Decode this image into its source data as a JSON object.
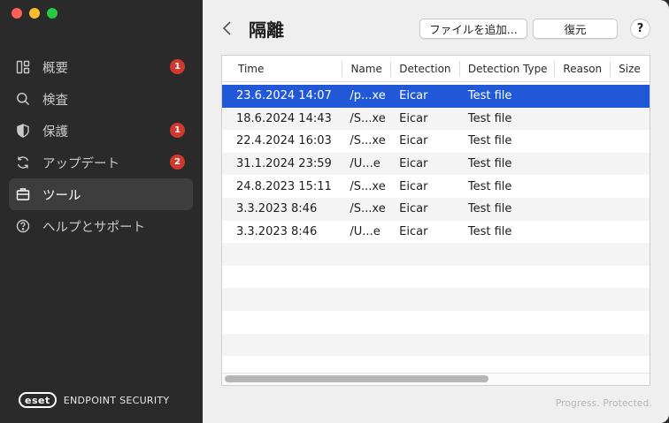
{
  "sidebar": {
    "items": [
      {
        "label": "概要",
        "icon": "dashboard-icon",
        "badge": "1"
      },
      {
        "label": "検査",
        "icon": "search-icon",
        "badge": ""
      },
      {
        "label": "保護",
        "icon": "shield-icon",
        "badge": "1"
      },
      {
        "label": "アップデート",
        "icon": "refresh-icon",
        "badge": "2"
      },
      {
        "label": "ツール",
        "icon": "briefcase-icon",
        "badge": ""
      },
      {
        "label": "ヘルプとサポート",
        "icon": "help-icon",
        "badge": ""
      }
    ],
    "active_index": 4,
    "brand_logo": "eset",
    "brand_text": "ENDPOINT SECURITY"
  },
  "header": {
    "title": "隔離",
    "add_file_label": "ファイルを追加...",
    "restore_label": "復元",
    "help_label": "?"
  },
  "table": {
    "columns": [
      "Time",
      "Name",
      "Detection",
      "Detection Type",
      "Reason",
      "Size"
    ],
    "rows": [
      {
        "time": "23.6.2024 14:07",
        "name": "/p...xe",
        "detection": "Eicar",
        "type": "Test file",
        "reason": "",
        "size": "",
        "selected": true
      },
      {
        "time": "18.6.2024 14:43",
        "name": "/S...xe",
        "detection": "Eicar",
        "type": "Test file",
        "reason": "",
        "size": ""
      },
      {
        "time": "22.4.2024 16:03",
        "name": "/S...xe",
        "detection": "Eicar",
        "type": "Test file",
        "reason": "",
        "size": ""
      },
      {
        "time": "31.1.2024 23:59",
        "name": "/U...e",
        "detection": "Eicar",
        "type": "Test file",
        "reason": "",
        "size": ""
      },
      {
        "time": "24.8.2023 15:11",
        "name": "/S...xe",
        "detection": "Eicar",
        "type": "Test file",
        "reason": "",
        "size": ""
      },
      {
        "time": "3.3.2023 8:46",
        "name": "/S...xe",
        "detection": "Eicar",
        "type": "Test file",
        "reason": "",
        "size": ""
      },
      {
        "time": "3.3.2023 8:46",
        "name": "/U...e",
        "detection": "Eicar",
        "type": "Test file",
        "reason": "",
        "size": ""
      }
    ]
  },
  "footer": {
    "tagline": "Progress. Protected."
  },
  "colors": {
    "selected_row": "#2058d8",
    "badge": "#d0392f",
    "sidebar_bg": "#2a2a2a",
    "main_bg": "#efefef"
  }
}
